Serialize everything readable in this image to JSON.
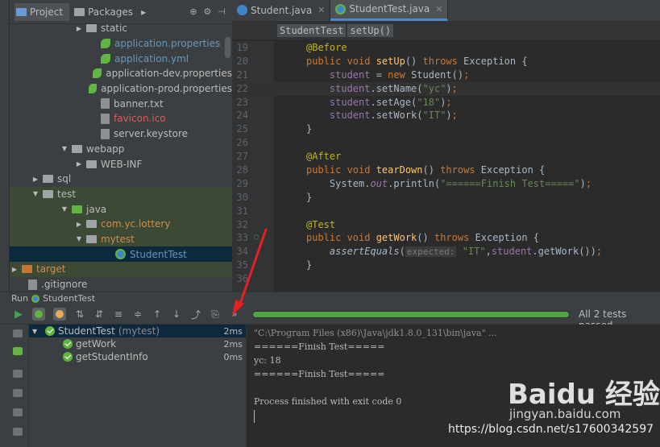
{
  "project_panel": {
    "tabs": [
      "Project",
      "Packages"
    ],
    "tree": [
      {
        "label": "static",
        "indent": 0,
        "arrow": "▶",
        "icon": "folder",
        "color": ""
      },
      {
        "label": "application.properties",
        "indent": 1,
        "arrow": "",
        "icon": "leaf",
        "color": "blue"
      },
      {
        "label": "application.yml",
        "indent": 1,
        "arrow": "",
        "icon": "leaf",
        "color": "blue"
      },
      {
        "label": "application-dev.properties",
        "indent": 1,
        "arrow": "",
        "icon": "leaf",
        "color": ""
      },
      {
        "label": "application-prod.properties",
        "indent": 1,
        "arrow": "",
        "icon": "leaf",
        "color": ""
      },
      {
        "label": "banner.txt",
        "indent": 1,
        "arrow": "",
        "icon": "file",
        "color": ""
      },
      {
        "label": "favicon.ico",
        "indent": 1,
        "arrow": "",
        "icon": "file",
        "color": "red"
      },
      {
        "label": "server.keystore",
        "indent": 1,
        "arrow": "",
        "icon": "file",
        "color": ""
      },
      {
        "label": "webapp",
        "indent": -1,
        "arrow": "▼",
        "icon": "folder",
        "color": ""
      },
      {
        "label": "WEB-INF",
        "indent": 0,
        "arrow": "▶",
        "icon": "folder",
        "color": ""
      },
      {
        "label": "sql",
        "indent": -3,
        "arrow": "▶",
        "icon": "folder",
        "color": ""
      },
      {
        "label": "test",
        "indent": -3,
        "arrow": "▼",
        "icon": "folder",
        "color": "",
        "highlight": true
      },
      {
        "label": "java",
        "indent": -1,
        "arrow": "▼",
        "icon": "folder-green",
        "color": "",
        "highlight": true
      },
      {
        "label": "com.yc.lottery",
        "indent": 0,
        "arrow": "▶",
        "icon": "folder",
        "color": "orange",
        "highlight": true
      },
      {
        "label": "mytest",
        "indent": 0,
        "arrow": "▼",
        "icon": "folder",
        "color": "orange",
        "highlight": true
      },
      {
        "label": "StudentTest",
        "indent": 2,
        "arrow": "",
        "icon": "test",
        "color": "blue",
        "selected": true
      },
      {
        "label": "target",
        "indent": -5,
        "arrow": "▶",
        "icon": "folder-orange",
        "color": "orange",
        "highlight": true
      },
      {
        "label": ".gitignore",
        "indent": -4,
        "arrow": "",
        "icon": "file",
        "color": ""
      }
    ]
  },
  "editor": {
    "tabs": [
      {
        "label": "Student.java",
        "active": false
      },
      {
        "label": "StudentTest.java",
        "active": true
      }
    ],
    "breadcrumb": [
      "StudentTest",
      "setUp()"
    ],
    "lines": [
      {
        "n": "19",
        "html": "<span class=\"an\">@Before</span>"
      },
      {
        "n": "20",
        "html": "<span class=\"kw\">public void </span><span class=\"fn\">setUp</span>() <span class=\"kw\">throws </span>Exception {"
      },
      {
        "n": "21",
        "html": "    <span class=\"fld\">student </span>= <span class=\"kw\">new </span>Student()<span class=\"kw\">;</span>"
      },
      {
        "n": "22",
        "html": "    <span class=\"fld\">student</span>.setName(<span class=\"st\">\"yc\"</span>)<span class=\"kw\">;</span>",
        "current": true
      },
      {
        "n": "23",
        "html": "    <span class=\"fld\">student</span>.setAge(<span class=\"st\">\"18\"</span>)<span class=\"kw\">;</span>"
      },
      {
        "n": "24",
        "html": "    <span class=\"fld\">student</span>.setWork(<span class=\"st\">\"IT\"</span>)<span class=\"kw\">;</span>"
      },
      {
        "n": "25",
        "html": "}"
      },
      {
        "n": "26",
        "html": ""
      },
      {
        "n": "27",
        "html": "<span class=\"an\">@After</span>"
      },
      {
        "n": "28",
        "html": "<span class=\"kw\">public void </span><span class=\"fn\">tearDown</span>() <span class=\"kw\">throws </span>Exception {"
      },
      {
        "n": "29",
        "html": "    System.<span class=\"fld it\">out</span>.println(<span class=\"st\">\"======Finish Test=====\"</span>)<span class=\"kw\">;</span>"
      },
      {
        "n": "30",
        "html": "}"
      },
      {
        "n": "31",
        "html": ""
      },
      {
        "n": "32",
        "html": "<span class=\"an\">@Test</span>"
      },
      {
        "n": "33",
        "html": "<span class=\"kw\">public void </span><span class=\"fn\">getWork</span>() <span class=\"kw\">throws </span>Exception {",
        "marker": true
      },
      {
        "n": "34",
        "html": "    <span class=\"it\">assertEquals</span>(<span class=\"hint\">expected:</span> <span class=\"st\">\"IT\"</span>,<span class=\"fld\">student</span>.getWork())<span class=\"kw\">;</span>"
      },
      {
        "n": "35",
        "html": "}"
      },
      {
        "n": "36",
        "html": ""
      }
    ]
  },
  "run_panel": {
    "run_label": "Run",
    "config_name": "StudentTest",
    "tests_status": "All 2 tests passed",
    "progress_fraction": 1.0,
    "tests": [
      {
        "label": "StudentTest",
        "sub": "(mytest)",
        "time": "2ms",
        "root": true
      },
      {
        "label": "getWork",
        "sub": "",
        "time": "2ms",
        "root": false
      },
      {
        "label": "getStudentInfo",
        "sub": "",
        "time": "0ms",
        "root": false
      }
    ],
    "console": [
      {
        "text": "\"C:\\Program Files (x86)\\Java\\jdk1.8.0_131\\bin\\java\" ...",
        "cmd": true
      },
      {
        "text": "======Finish Test=====",
        "cmd": false
      },
      {
        "text": "yc: 18",
        "cmd": false
      },
      {
        "text": "======Finish Test=====",
        "cmd": false
      },
      {
        "text": "",
        "cmd": false
      },
      {
        "text": "Process finished with exit code 0",
        "cmd": false
      }
    ]
  },
  "watermark": {
    "logo": "Baidu 经验",
    "sub": "jingyan.baidu.com",
    "url": "https://blog.csdn.net/s17600342597"
  },
  "colors": {
    "accent_blue": "#4a88c7",
    "pass_green": "#62b543",
    "annotation_red": "#e62020"
  }
}
